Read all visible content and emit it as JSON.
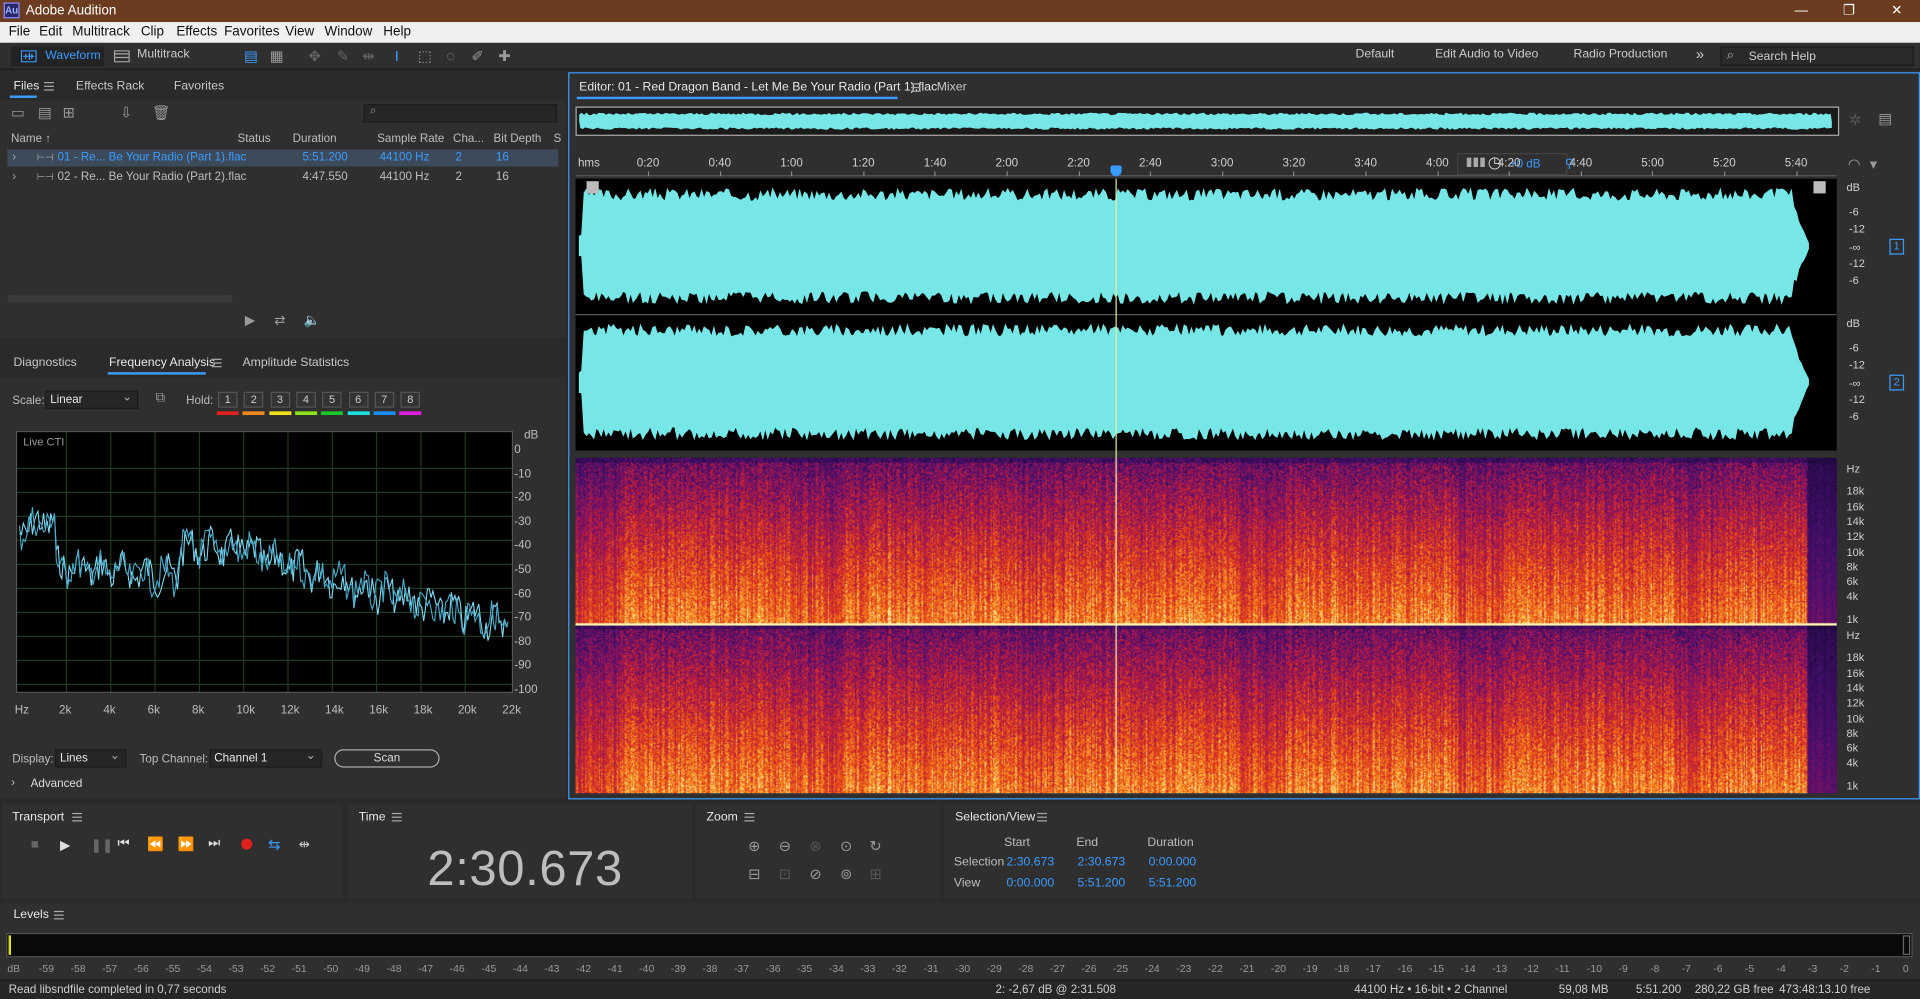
{
  "titlebar": {
    "logo": "Au",
    "title": "Adobe Audition",
    "min_icon": "minimize-icon",
    "max_icon": "restore-icon",
    "close_icon": "close-icon",
    "min": "—",
    "max": "❐",
    "close": "✕"
  },
  "menu": [
    "File",
    "Edit",
    "Multitrack",
    "Clip",
    "Effects",
    "Favorites",
    "View",
    "Window",
    "Help"
  ],
  "toolbar": {
    "waveform": "Waveform",
    "multitrack": "Multitrack",
    "workspaces": [
      "Default",
      "Edit Audio to Video",
      "Radio Production"
    ],
    "more": "»",
    "search_placeholder": "Search Help"
  },
  "files_panel": {
    "tabs": [
      "Files",
      "Effects Rack",
      "Favorites"
    ],
    "columns": [
      "Name ↑",
      "Status",
      "Duration",
      "Sample Rate",
      "Cha...",
      "Bit Depth",
      "S"
    ],
    "rows": [
      {
        "name": "01 - Re... Be Your Radio (Part 1).flac",
        "duration": "5:51.200",
        "rate": "44100 Hz",
        "ch": "2",
        "bits": "16",
        "selected": true
      },
      {
        "name": "02 - Re... Be Your Radio (Part 2).flac",
        "duration": "4:47.550",
        "rate": "44100 Hz",
        "ch": "2",
        "bits": "16",
        "selected": false
      }
    ],
    "search_placeholder": ""
  },
  "analysis_panel": {
    "tabs": [
      "Diagnostics",
      "Frequency Analysis",
      "Amplitude Statistics"
    ],
    "scale_label": "Scale:",
    "scale_value": "Linear",
    "hold_label": "Hold:",
    "hold": [
      "1",
      "2",
      "3",
      "4",
      "5",
      "6",
      "7",
      "8"
    ],
    "hold_colors": [
      "#e0201c",
      "#f08a1c",
      "#f0e01c",
      "#8ce01c",
      "#1cc828",
      "#1ce0e0",
      "#1c8cf0",
      "#e01ce0"
    ],
    "live_label": "Live CTI",
    "y_unit": "dB",
    "y_ticks": [
      "0",
      "-10",
      "-20",
      "-30",
      "-40",
      "-50",
      "-60",
      "-70",
      "-80",
      "-90",
      "-100"
    ],
    "x_ticks": [
      "Hz",
      "2k",
      "4k",
      "6k",
      "8k",
      "10k",
      "12k",
      "14k",
      "16k",
      "18k",
      "20k",
      "22k"
    ],
    "display_label": "Display:",
    "display_value": "Lines",
    "top_channel_label": "Top Channel:",
    "top_channel_value": "Channel 1",
    "scan_label": "Scan",
    "advanced_label": "Advanced",
    "spectrum_color": "#7fd8f0"
  },
  "editor": {
    "tab": "Editor: 01 - Red Dragon Band - Let Me Be Your Radio (Part 1).flac",
    "mixer": "Mixer",
    "ruler_unit": "hms",
    "ruler": [
      "0:20",
      "0:40",
      "1:00",
      "1:20",
      "1:40",
      "2:00",
      "2:20",
      "2:40",
      "3:00",
      "3:20",
      "3:40",
      "4:00",
      "4:20",
      "4:40",
      "5:00",
      "5:20",
      "5:40"
    ],
    "gain": "+0 dB",
    "db_ticks": [
      "dB",
      "-6",
      "-12",
      "-∞",
      "-12",
      "-6"
    ],
    "channels": [
      "1",
      "2"
    ],
    "hz_ticks": [
      "Hz",
      "18k",
      "16k",
      "14k",
      "12k",
      "10k",
      "8k",
      "6k",
      "4k",
      "1k"
    ],
    "wave_color": "#76e6e6"
  },
  "transport": {
    "title": "Transport"
  },
  "time": {
    "title": "Time",
    "value": "2:30.673"
  },
  "zoom": {
    "title": "Zoom"
  },
  "selection": {
    "title": "Selection/View",
    "headers": [
      "Start",
      "End",
      "Duration"
    ],
    "rows": [
      {
        "label": "Selection",
        "start": "2:30.673",
        "end": "2:30.673",
        "dur": "0:00.000"
      },
      {
        "label": "View",
        "start": "0:00.000",
        "end": "5:51.200",
        "dur": "5:51.200"
      }
    ]
  },
  "levels": {
    "title": "Levels",
    "ticks": [
      "dB",
      "-59",
      "-58",
      "-57",
      "-56",
      "-55",
      "-54",
      "-53",
      "-52",
      "-51",
      "-50",
      "-49",
      "-48",
      "-47",
      "-46",
      "-45",
      "-44",
      "-43",
      "-42",
      "-41",
      "-40",
      "-39",
      "-38",
      "-37",
      "-36",
      "-35",
      "-34",
      "-33",
      "-32",
      "-31",
      "-30",
      "-29",
      "-28",
      "-27",
      "-26",
      "-25",
      "-24",
      "-23",
      "-22",
      "-21",
      "-20",
      "-19",
      "-18",
      "-17",
      "-16",
      "-15",
      "-14",
      "-13",
      "-12",
      "-11",
      "-10",
      "-9",
      "-8",
      "-7",
      "-6",
      "-5",
      "-4",
      "-3",
      "-2",
      "-1",
      "0"
    ]
  },
  "status": {
    "left": "Read libsndfile completed in 0,77 seconds",
    "cursor": "2: -2,67 dB @ 2:31.508",
    "format": "44100 Hz • 16-bit • 2 Channel",
    "size": "59,08 MB",
    "duration": "5:51.200",
    "free": "280,22 GB free",
    "free_time": "473:48:13.10 free"
  }
}
